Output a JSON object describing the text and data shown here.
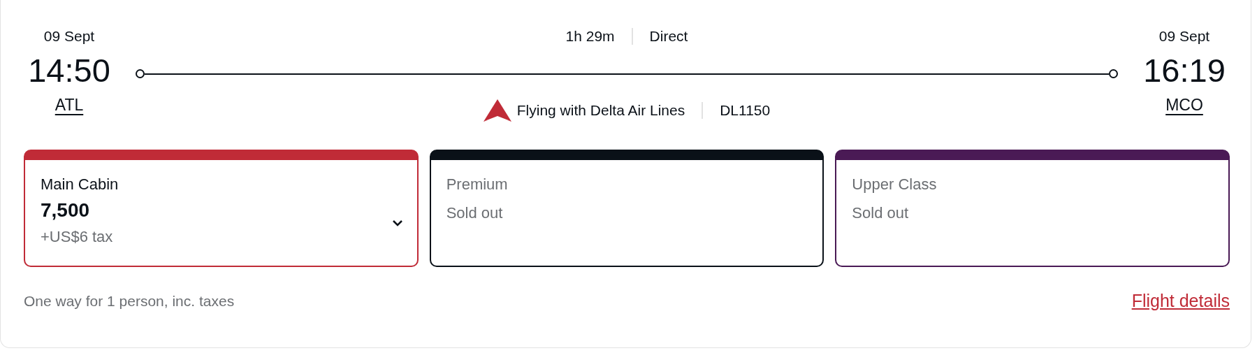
{
  "departure": {
    "date": "09 Sept",
    "time": "14:50",
    "airport": "ATL"
  },
  "arrival": {
    "date": "09 Sept",
    "time": "16:19",
    "airport": "MCO"
  },
  "duration": "1h 29m",
  "stops": "Direct",
  "operator": "Flying with Delta Air Lines",
  "flight_number": "DL1150",
  "cabins": [
    {
      "kind": "available",
      "name": "Main Cabin",
      "color": "#c02b37",
      "price": "7,500",
      "tax": "+US$6 tax"
    },
    {
      "kind": "sold_out",
      "name": "Premium",
      "color": "#0a1118",
      "status": "Sold out"
    },
    {
      "kind": "sold_out",
      "name": "Upper Class",
      "color": "#4a1a55",
      "status": "Sold out"
    }
  ],
  "footer": {
    "note": "One way for 1 person, inc. taxes",
    "link": "Flight details"
  }
}
